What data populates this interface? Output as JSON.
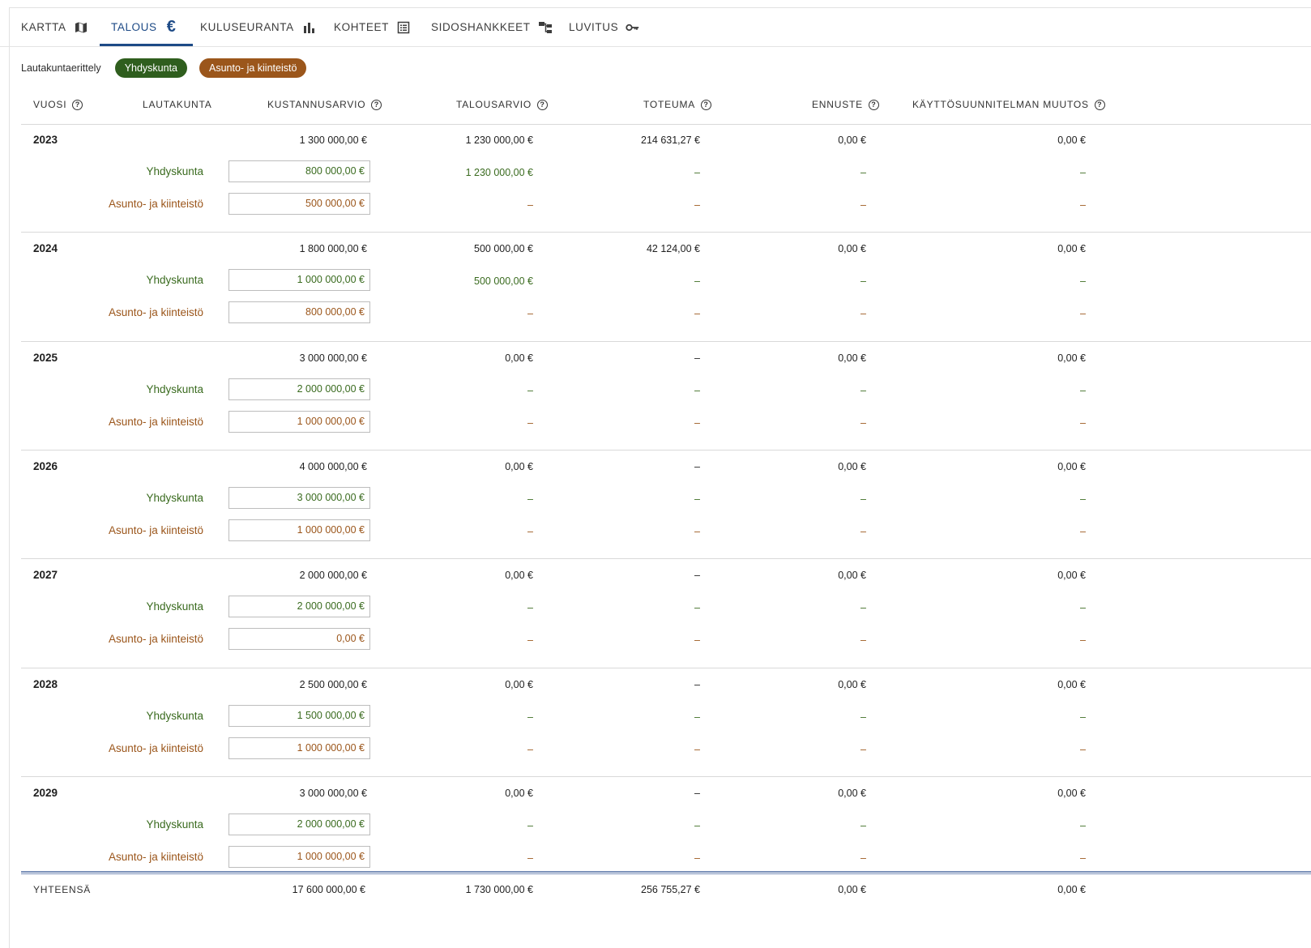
{
  "tabs": [
    {
      "label": "KARTTA",
      "icon": "map-icon",
      "active": false
    },
    {
      "label": "TALOUS",
      "icon": "euro-icon",
      "active": true
    },
    {
      "label": "KULUSEURANTA",
      "icon": "bar-chart-icon",
      "active": false
    },
    {
      "label": "KOHTEET",
      "icon": "list-icon",
      "active": false
    },
    {
      "label": "SIDOSHANKKEET",
      "icon": "hierarchy-icon",
      "active": false
    },
    {
      "label": "LUVITUS",
      "icon": "key-icon",
      "active": false
    }
  ],
  "filter": {
    "label": "Lautakuntaerittely",
    "chips": [
      "Yhdyskunta",
      "Asunto- ja kiinteistö"
    ]
  },
  "colors": {
    "active_tab": "#1d4a86",
    "yhdyskunta": "#2f5e1e",
    "asunto": "#9b561b"
  },
  "table": {
    "headers": {
      "vuosi": "VUOSI",
      "lautakunta": "LAUTAKUNTA",
      "kustannusarvio": "KUSTANNUSARVIO",
      "talousarvio": "TALOUSARVIO",
      "toteuma": "TOTEUMA",
      "ennuste": "ENNUSTE",
      "muutos": "KÄYTTÖSUUNNITELMAN MUUTOS"
    },
    "years": [
      {
        "year": "2023",
        "kustannusarvio": "1 300 000,00 €",
        "talousarvio": "1 230 000,00 €",
        "toteuma": "214 631,27 €",
        "ennuste": "0,00 €",
        "muutos": "0,00 €",
        "boards": [
          {
            "name": "Yhdyskunta",
            "kustannusarvio": "800 000,00 €",
            "talousarvio": "1 230 000,00 €",
            "toteuma": "–",
            "ennuste": "–",
            "muutos": "–"
          },
          {
            "name": "Asunto- ja kiinteistö",
            "kustannusarvio": "500 000,00 €",
            "talousarvio": "–",
            "toteuma": "–",
            "ennuste": "–",
            "muutos": "–"
          }
        ]
      },
      {
        "year": "2024",
        "kustannusarvio": "1 800 000,00 €",
        "talousarvio": "500 000,00 €",
        "toteuma": "42 124,00 €",
        "ennuste": "0,00 €",
        "muutos": "0,00 €",
        "boards": [
          {
            "name": "Yhdyskunta",
            "kustannusarvio": "1 000 000,00 €",
            "talousarvio": "500 000,00 €",
            "toteuma": "–",
            "ennuste": "–",
            "muutos": "–"
          },
          {
            "name": "Asunto- ja kiinteistö",
            "kustannusarvio": "800 000,00 €",
            "talousarvio": "–",
            "toteuma": "–",
            "ennuste": "–",
            "muutos": "–"
          }
        ]
      },
      {
        "year": "2025",
        "kustannusarvio": "3 000 000,00 €",
        "talousarvio": "0,00 €",
        "toteuma": "–",
        "ennuste": "0,00 €",
        "muutos": "0,00 €",
        "boards": [
          {
            "name": "Yhdyskunta",
            "kustannusarvio": "2 000 000,00 €",
            "talousarvio": "–",
            "toteuma": "–",
            "ennuste": "–",
            "muutos": "–"
          },
          {
            "name": "Asunto- ja kiinteistö",
            "kustannusarvio": "1 000 000,00 €",
            "talousarvio": "–",
            "toteuma": "–",
            "ennuste": "–",
            "muutos": "–"
          }
        ]
      },
      {
        "year": "2026",
        "kustannusarvio": "4 000 000,00 €",
        "talousarvio": "0,00 €",
        "toteuma": "–",
        "ennuste": "0,00 €",
        "muutos": "0,00 €",
        "boards": [
          {
            "name": "Yhdyskunta",
            "kustannusarvio": "3 000 000,00 €",
            "talousarvio": "–",
            "toteuma": "–",
            "ennuste": "–",
            "muutos": "–"
          },
          {
            "name": "Asunto- ja kiinteistö",
            "kustannusarvio": "1 000 000,00 €",
            "talousarvio": "–",
            "toteuma": "–",
            "ennuste": "–",
            "muutos": "–"
          }
        ]
      },
      {
        "year": "2027",
        "kustannusarvio": "2 000 000,00 €",
        "talousarvio": "0,00 €",
        "toteuma": "–",
        "ennuste": "0,00 €",
        "muutos": "0,00 €",
        "boards": [
          {
            "name": "Yhdyskunta",
            "kustannusarvio": "2 000 000,00 €",
            "talousarvio": "–",
            "toteuma": "–",
            "ennuste": "–",
            "muutos": "–"
          },
          {
            "name": "Asunto- ja kiinteistö",
            "kustannusarvio": "0,00 €",
            "talousarvio": "–",
            "toteuma": "–",
            "ennuste": "–",
            "muutos": "–"
          }
        ]
      },
      {
        "year": "2028",
        "kustannusarvio": "2 500 000,00 €",
        "talousarvio": "0,00 €",
        "toteuma": "–",
        "ennuste": "0,00 €",
        "muutos": "0,00 €",
        "boards": [
          {
            "name": "Yhdyskunta",
            "kustannusarvio": "1 500 000,00 €",
            "talousarvio": "–",
            "toteuma": "–",
            "ennuste": "–",
            "muutos": "–"
          },
          {
            "name": "Asunto- ja kiinteistö",
            "kustannusarvio": "1 000 000,00 €",
            "talousarvio": "–",
            "toteuma": "–",
            "ennuste": "–",
            "muutos": "–"
          }
        ]
      },
      {
        "year": "2029",
        "kustannusarvio": "3 000 000,00 €",
        "talousarvio": "0,00 €",
        "toteuma": "–",
        "ennuste": "0,00 €",
        "muutos": "0,00 €",
        "boards": [
          {
            "name": "Yhdyskunta",
            "kustannusarvio": "2 000 000,00 €",
            "talousarvio": "–",
            "toteuma": "–",
            "ennuste": "–",
            "muutos": "–"
          },
          {
            "name": "Asunto- ja kiinteistö",
            "kustannusarvio": "1 000 000,00 €",
            "talousarvio": "–",
            "toteuma": "–",
            "ennuste": "–",
            "muutos": "–"
          }
        ]
      }
    ],
    "total": {
      "label": "YHTEENSÄ",
      "kustannusarvio": "17 600 000,00 €",
      "talousarvio": "1 730 000,00 €",
      "toteuma": "256 755,27 €",
      "ennuste": "0,00 €",
      "muutos": "0,00 €"
    }
  }
}
